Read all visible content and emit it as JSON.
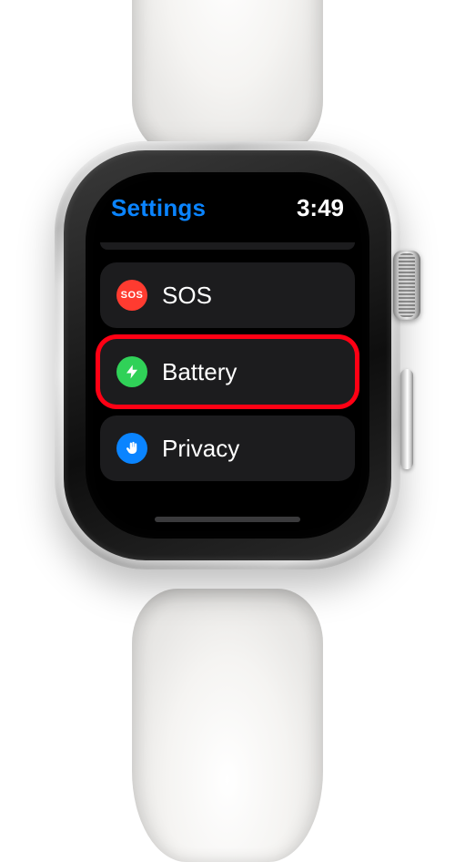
{
  "header": {
    "back_label": "Settings",
    "time": "3:49"
  },
  "rows": [
    {
      "id": "sos",
      "label": "SOS",
      "icon": "sos-icon",
      "icon_color": "#ff3b30",
      "highlighted": false
    },
    {
      "id": "battery",
      "label": "Battery",
      "icon": "bolt-icon",
      "icon_color": "#30d158",
      "highlighted": true
    },
    {
      "id": "privacy",
      "label": "Privacy",
      "icon": "hand-icon",
      "icon_color": "#0a84ff",
      "highlighted": false
    }
  ],
  "icons": {
    "sos_text": "SOS"
  }
}
